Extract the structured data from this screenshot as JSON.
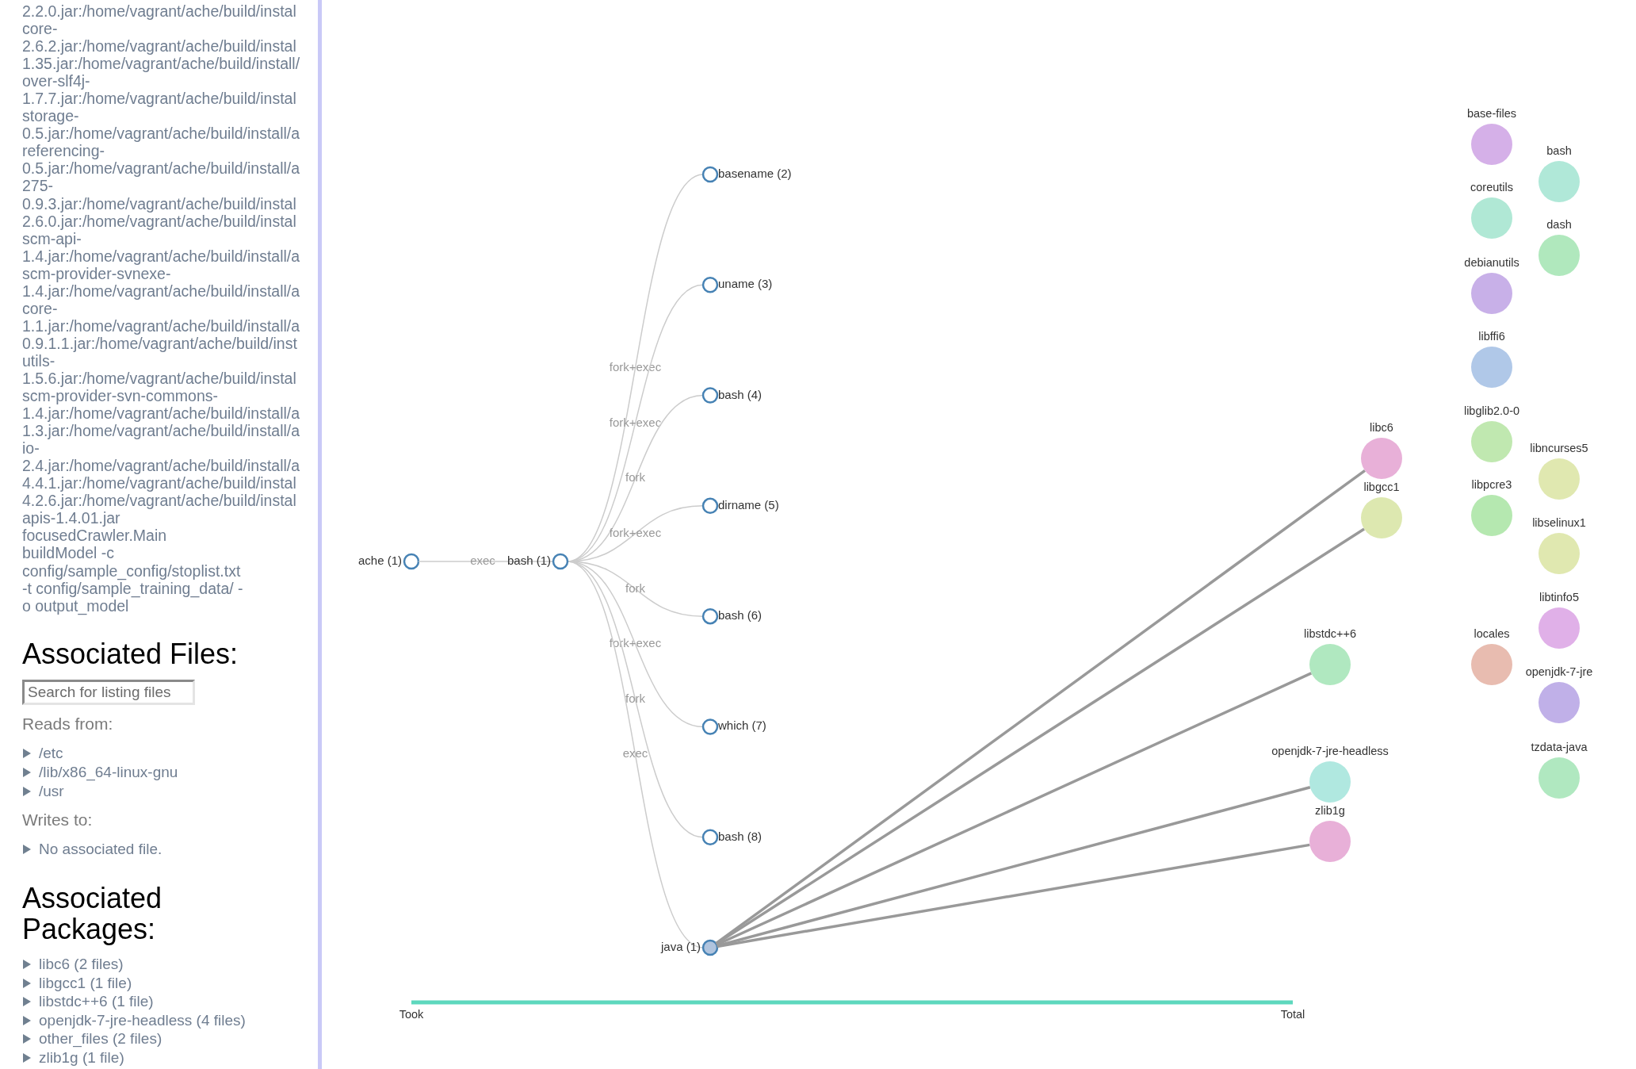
{
  "sidebar": {
    "command_lines": [
      "2.2.0.jar:/home/vagrant/ache/build/instal",
      "core-",
      "2.6.2.jar:/home/vagrant/ache/build/instal",
      "1.35.jar:/home/vagrant/ache/build/install/",
      "over-slf4j-",
      "1.7.7.jar:/home/vagrant/ache/build/instal",
      "storage-",
      "0.5.jar:/home/vagrant/ache/build/install/a",
      "referencing-",
      "0.5.jar:/home/vagrant/ache/build/install/a",
      "275-",
      "0.9.3.jar:/home/vagrant/ache/build/instal",
      "2.6.0.jar:/home/vagrant/ache/build/instal",
      "scm-api-",
      "1.4.jar:/home/vagrant/ache/build/install/a",
      "scm-provider-svnexe-",
      "1.4.jar:/home/vagrant/ache/build/install/a",
      "core-",
      "1.1.jar:/home/vagrant/ache/build/install/a",
      "0.9.1.1.jar:/home/vagrant/ache/build/inst",
      "utils-",
      "1.5.6.jar:/home/vagrant/ache/build/instal",
      "scm-provider-svn-commons-",
      "1.4.jar:/home/vagrant/ache/build/install/a",
      "1.3.jar:/home/vagrant/ache/build/install/a",
      "io-",
      "2.4.jar:/home/vagrant/ache/build/install/a",
      "4.4.1.jar:/home/vagrant/ache/build/instal",
      "4.2.6.jar:/home/vagrant/ache/build/instal",
      "apis-1.4.01.jar",
      "focusedCrawler.Main",
      "buildModel -c",
      "config/sample_config/stoplist.txt",
      "-t config/sample_training_data/ -",
      "o output_model"
    ],
    "files_heading": "Associated Files:",
    "search": {
      "placeholder": "Search for listing files"
    },
    "reads_label": "Reads from:",
    "reads": [
      {
        "label": "/etc",
        "expanded": false
      },
      {
        "label": "/lib/x86_64-linux-gnu",
        "expanded": false
      },
      {
        "label": "/usr",
        "expanded": false
      }
    ],
    "writes_label": "Writes to:",
    "writes": [
      {
        "label": "No associated file.",
        "expanded": false
      }
    ],
    "packages_heading": "Associated Packages:",
    "packages": [
      {
        "label": "libc6 (2 files)",
        "expanded": false
      },
      {
        "label": "libgcc1 (1 file)",
        "expanded": false
      },
      {
        "label": "libstdc++6 (1 file)",
        "expanded": false
      },
      {
        "label": "openjdk-7-jre-headless (4 files)",
        "expanded": false
      },
      {
        "label": "other_files (2 files)",
        "expanded": false
      },
      {
        "label": "zlib1g (1 file)",
        "expanded": false
      }
    ]
  },
  "process_tree": {
    "label": "ache (1)",
    "collapsed": false,
    "children": [
      {
        "label": "bash (1)",
        "edge_label": "exec",
        "collapsed": false,
        "children": [
          {
            "label": "basename (2)",
            "edge_label": "fork+exec",
            "collapsed": false
          },
          {
            "label": "uname (3)",
            "edge_label": "fork+exec",
            "collapsed": false
          },
          {
            "label": "bash (4)",
            "edge_label": "fork",
            "collapsed": false
          },
          {
            "label": "dirname (5)",
            "edge_label": "fork+exec",
            "collapsed": false
          },
          {
            "label": "bash (6)",
            "edge_label": "fork",
            "collapsed": false
          },
          {
            "label": "which (7)",
            "edge_label": "fork+exec",
            "collapsed": false
          },
          {
            "label": "bash (8)",
            "edge_label": "fork",
            "collapsed": false
          },
          {
            "label": "java (1)",
            "edge_label": "exec",
            "collapsed": true
          }
        ]
      }
    ]
  },
  "packages": [
    {
      "name": "libc6",
      "color": "#e8b0d8",
      "linked": true
    },
    {
      "name": "libgcc1",
      "color": "#dde8b0",
      "linked": true
    },
    {
      "name": "libstdc++6",
      "color": "#b0e8c0",
      "linked": true
    },
    {
      "name": "openjdk-7-jre-headless",
      "color": "#b0e8e0",
      "linked": true
    },
    {
      "name": "zlib1g",
      "color": "#e8b0d8",
      "linked": true
    },
    {
      "name": "base-files",
      "color": "#d5b0e8",
      "linked": false
    },
    {
      "name": "bash",
      "color": "#b0e8d8",
      "linked": false
    },
    {
      "name": "coreutils",
      "color": "#b0e8d5",
      "linked": false
    },
    {
      "name": "dash",
      "color": "#b0e8bd",
      "linked": false
    },
    {
      "name": "debianutils",
      "color": "#c8b0e8",
      "linked": false
    },
    {
      "name": "libffi6",
      "color": "#b0c8e8",
      "linked": false
    },
    {
      "name": "libglib2.0-0",
      "color": "#c0e8b0",
      "linked": false
    },
    {
      "name": "libncurses5",
      "color": "#e0e8b0",
      "linked": false
    },
    {
      "name": "libpcre3",
      "color": "#b5e8b0",
      "linked": false
    },
    {
      "name": "libselinux1",
      "color": "#e0e8b0",
      "linked": false
    },
    {
      "name": "libtinfo5",
      "color": "#e0b0e8",
      "linked": false
    },
    {
      "name": "locales",
      "color": "#e8bcb0",
      "linked": false
    },
    {
      "name": "openjdk-7-jre",
      "color": "#c0b0e8",
      "linked": false
    },
    {
      "name": "tzdata-java",
      "color": "#b0e8c0",
      "linked": false
    }
  ],
  "timeline": {
    "start_label": "Took",
    "end_label": "Total"
  }
}
